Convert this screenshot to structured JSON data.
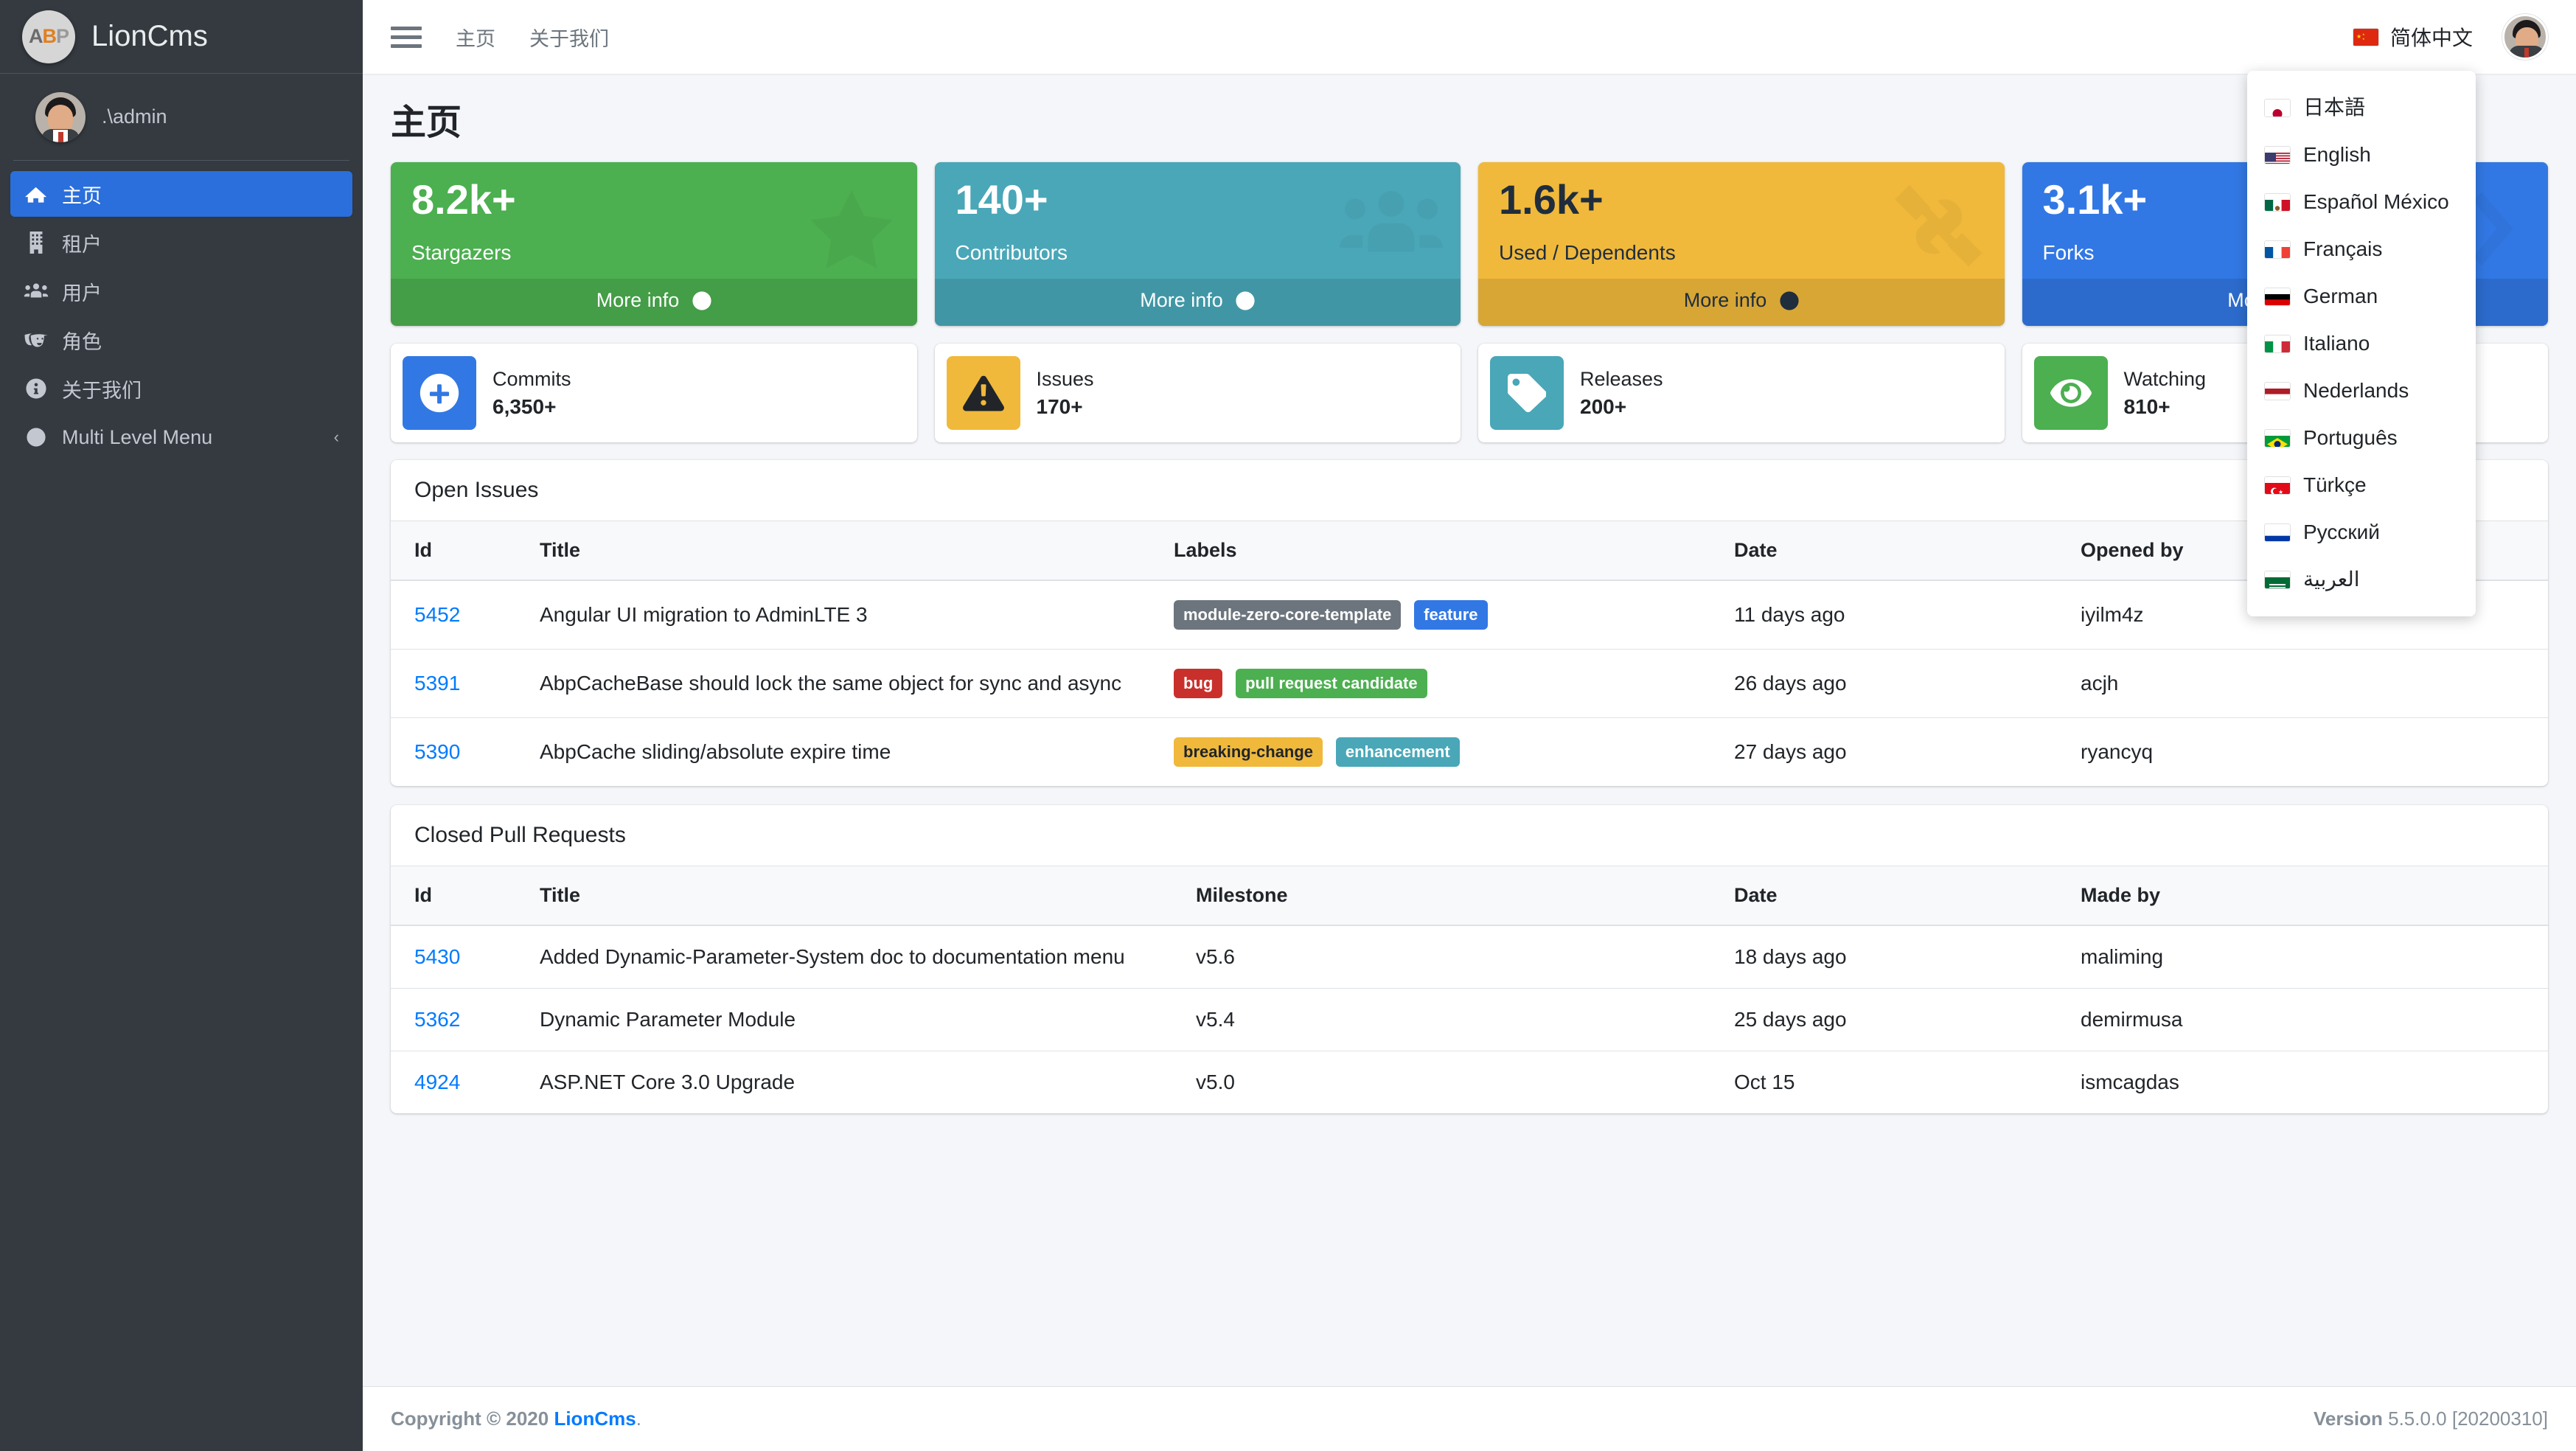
{
  "sidebar": {
    "brand": {
      "logo_text_a": "A",
      "logo_text_b": "B",
      "logo_text_p": "P",
      "title": "LionCms"
    },
    "user": {
      "name": ".\\admin",
      "avatar": "user-avatar"
    },
    "items": [
      {
        "label": "主页",
        "icon": "home-icon",
        "active": true
      },
      {
        "label": "租户",
        "icon": "building-icon",
        "active": false
      },
      {
        "label": "用户",
        "icon": "users-icon",
        "active": false
      },
      {
        "label": "角色",
        "icon": "theater-masks-icon",
        "active": false
      },
      {
        "label": "关于我们",
        "icon": "info-circle-icon",
        "active": false
      },
      {
        "label": "Multi Level Menu",
        "icon": "circle-icon",
        "active": false,
        "caret": "‹"
      }
    ]
  },
  "navbar": {
    "hamburger": "menu-icon",
    "links": [
      "主页",
      "关于我们"
    ],
    "language": {
      "flag": "cn",
      "label": "简体中文"
    },
    "avatar": "user-avatar"
  },
  "language_menu": {
    "items": [
      {
        "flag": "jp",
        "label": "日本語"
      },
      {
        "flag": "us",
        "label": "English"
      },
      {
        "flag": "mx",
        "label": "Español México"
      },
      {
        "flag": "fr",
        "label": "Français"
      },
      {
        "flag": "de",
        "label": "German"
      },
      {
        "flag": "it",
        "label": "Italiano"
      },
      {
        "flag": "nl",
        "label": "Nederlands"
      },
      {
        "flag": "br",
        "label": "Português"
      },
      {
        "flag": "tr",
        "label": "Türkçe"
      },
      {
        "flag": "ru",
        "label": "Русский"
      },
      {
        "flag": "sa",
        "label": "العربية"
      }
    ]
  },
  "page": {
    "title": "主页"
  },
  "small_boxes": [
    {
      "value": "8.2k+",
      "label": "Stargazers",
      "more": "More info",
      "bg": "#4CAF50",
      "fg": "#ffffff",
      "icon": "star-icon"
    },
    {
      "value": "140+",
      "label": "Contributors",
      "more": "More info",
      "bg": "#49A7B8",
      "fg": "#ffffff",
      "icon": "users-icon"
    },
    {
      "value": "1.6k+",
      "label": "Used / Dependents",
      "more": "More info",
      "bg": "#F0B93B",
      "fg": "#1f2d3d",
      "icon": "tools-icon"
    },
    {
      "value": "3.1k+",
      "label": "Forks",
      "more": "More info",
      "bg": "#3278E4",
      "fg": "#ffffff",
      "icon": "code-branch-icon"
    }
  ],
  "info_boxes": [
    {
      "label": "Commits",
      "number": "6,350+",
      "bg": "#3278E4",
      "icon": "plus-circle-icon"
    },
    {
      "label": "Issues",
      "number": "170+",
      "bg": "#F0B93B",
      "icon": "exclamation-triangle-icon"
    },
    {
      "label": "Releases",
      "number": "200+",
      "bg": "#49A7B8",
      "icon": "tag-icon"
    },
    {
      "label": "Watching",
      "number": "810+",
      "bg": "#4CAF50",
      "icon": "eye-icon"
    }
  ],
  "open_issues": {
    "title": "Open Issues",
    "columns": [
      "Id",
      "Title",
      "Labels",
      "Date",
      "Opened by"
    ],
    "rows": [
      {
        "id": "5452",
        "title": "Angular UI migration to AdminLTE 3",
        "labels": [
          {
            "text": "module-zero-core-template",
            "color": "#6c757d"
          },
          {
            "text": "feature",
            "color": "#3278E4"
          }
        ],
        "date": "11 days ago",
        "opened_by": "iyilm4z"
      },
      {
        "id": "5391",
        "title": "AbpCacheBase should lock the same object for sync and async",
        "labels": [
          {
            "text": "bug",
            "color": "#c9302c"
          },
          {
            "text": "pull request candidate",
            "color": "#4CAF50"
          }
        ],
        "date": "26 days ago",
        "opened_by": "acjh"
      },
      {
        "id": "5390",
        "title": "AbpCache sliding/absolute expire time",
        "labels": [
          {
            "text": "breaking-change",
            "color": "#F0B93B"
          },
          {
            "text": "enhancement",
            "color": "#49A7B8"
          }
        ],
        "date": "27 days ago",
        "opened_by": "ryancyq"
      }
    ]
  },
  "closed_prs": {
    "title": "Closed Pull Requests",
    "columns": [
      "Id",
      "Title",
      "Milestone",
      "Date",
      "Made by"
    ],
    "rows": [
      {
        "id": "5430",
        "title": "Added Dynamic-Parameter-System doc to documentation menu",
        "milestone": "v5.6",
        "date": "18 days ago",
        "made_by": "maliming"
      },
      {
        "id": "5362",
        "title": "Dynamic Parameter Module",
        "milestone": "v5.4",
        "date": "25 days ago",
        "made_by": "demirmusa"
      },
      {
        "id": "4924",
        "title": "ASP.NET Core 3.0 Upgrade",
        "milestone": "v5.0",
        "date": "Oct 15",
        "made_by": "ismcagdas"
      }
    ]
  },
  "footer": {
    "copyright_prefix": "Copyright © 2020",
    "copyright_link": "LionCms",
    "copyright_suffix": ".",
    "version_label": "Version",
    "version_value": "5.5.0.0 [20200310]"
  }
}
